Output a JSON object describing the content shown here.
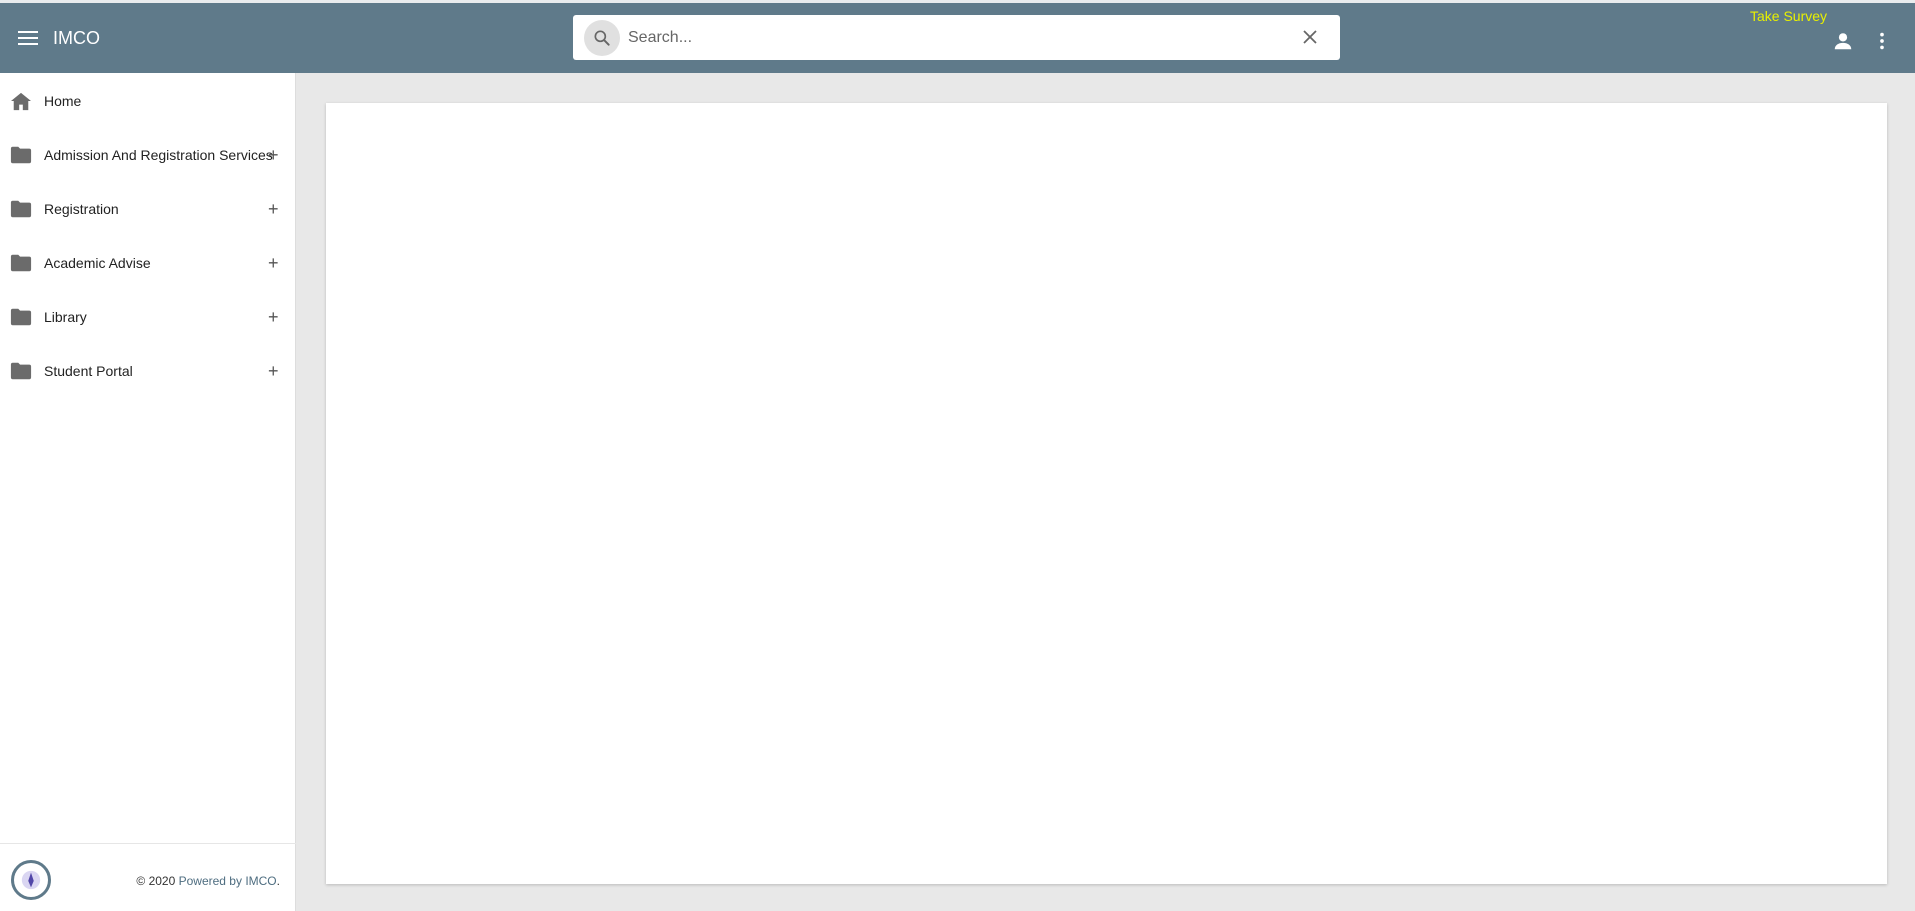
{
  "header": {
    "title": "IMCO",
    "search_placeholder": "Search...",
    "survey_label": "Take Survey",
    "menu_icon": "hamburger-icon",
    "user_icon": "person-icon",
    "more_icon": "kebab-icon"
  },
  "sidebar": {
    "items": [
      {
        "label": "Home",
        "icon": "home-icon",
        "expandable": false
      },
      {
        "label": "Admission And Registration Services",
        "icon": "folder-icon",
        "expandable": true
      },
      {
        "label": "Registration",
        "icon": "folder-icon",
        "expandable": true
      },
      {
        "label": "Academic Advise",
        "icon": "folder-icon",
        "expandable": true
      },
      {
        "label": "Library",
        "icon": "folder-icon",
        "expandable": true
      },
      {
        "label": "Student Portal",
        "icon": "folder-icon",
        "expandable": true
      }
    ],
    "expand_symbol": "+"
  },
  "footer": {
    "copyright": "© 2020 ",
    "powered_by": "Powered by IMCO",
    "period": "."
  },
  "colors": {
    "header_bg": "#5f7a8a",
    "survey_text": "#e8f000",
    "page_bg": "#e8e8e8"
  }
}
